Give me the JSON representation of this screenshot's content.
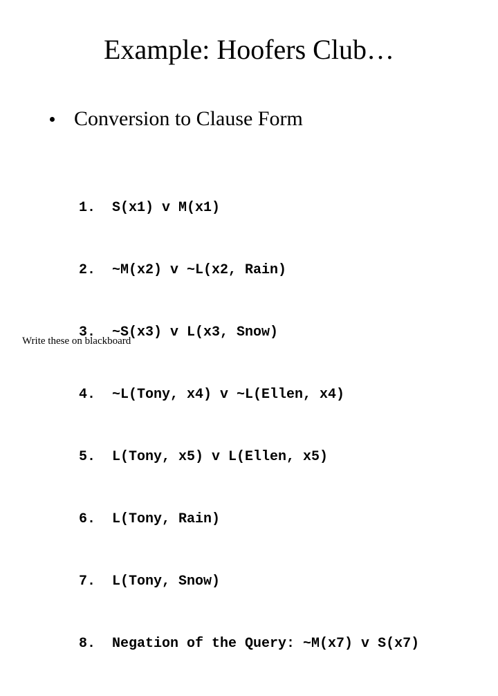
{
  "title": "Example: Hoofers Club…",
  "bullet": "Conversion to Clause Form",
  "clauses": [
    {
      "n": "1.",
      "text": "S(x1) v M(x1)"
    },
    {
      "n": "2.",
      "text": "~M(x2) v ~L(x2, Rain)"
    },
    {
      "n": "3.",
      "text": "~S(x3) v L(x3, Snow)"
    },
    {
      "n": "4.",
      "text": "~L(Tony, x4) v ~L(Ellen, x4)"
    },
    {
      "n": "5.",
      "text": "L(Tony, x5) v L(Ellen, x5)"
    },
    {
      "n": "6.",
      "text": "L(Tony, Rain)"
    },
    {
      "n": "7.",
      "text": "L(Tony, Snow)"
    },
    {
      "n": "8.",
      "text": "Negation of the Query: ~M(x7) v S(x7)"
    }
  ],
  "footnote": "Write these on blackboard"
}
